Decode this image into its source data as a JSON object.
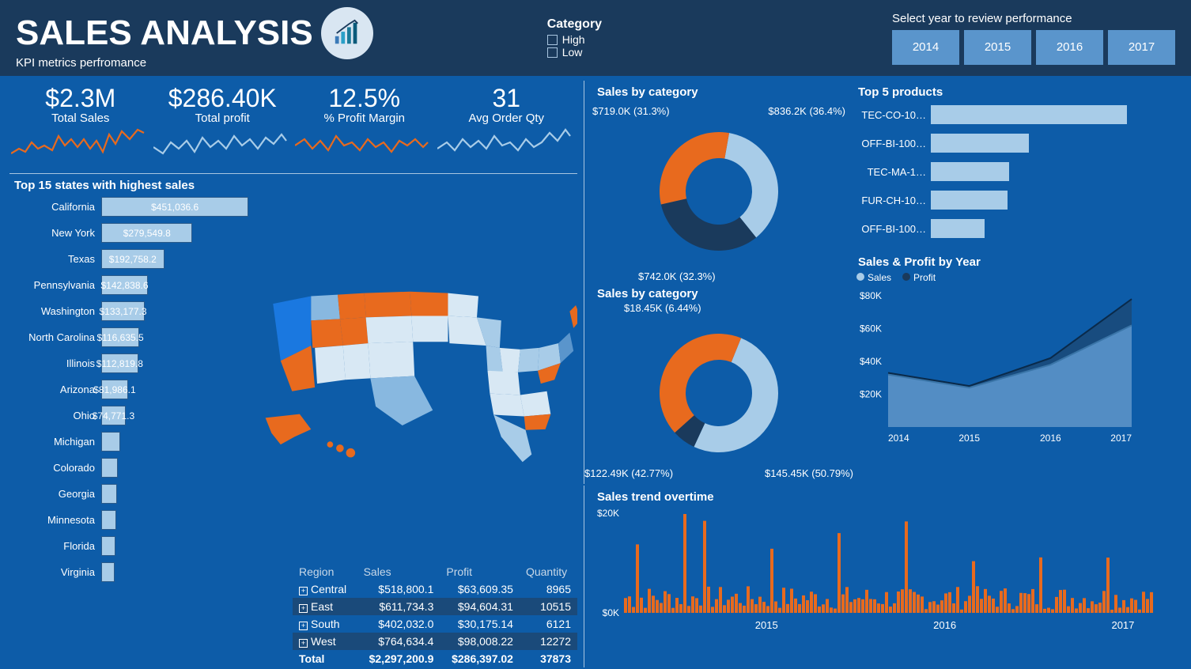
{
  "header": {
    "title": "SALES ANALYSIS",
    "subtitle": "KPI metrics perfromance",
    "category_label": "Category",
    "cat_high": "High",
    "cat_low": "Low",
    "year_label": "Select year to review performance",
    "years": [
      "2014",
      "2015",
      "2016",
      "2017"
    ]
  },
  "kpi": {
    "total_sales": {
      "value": "$2.3M",
      "label": "Total Sales"
    },
    "total_profit": {
      "value": "$286.40K",
      "label": "Total profit"
    },
    "margin": {
      "value": "12.5%",
      "label": "% Profit Margin"
    },
    "avg_qty": {
      "value": "31",
      "label": "Avg Order Qty"
    }
  },
  "top_states_title": "Top 15 states with highest sales",
  "region_headers": {
    "region": "Region",
    "sales": "Sales",
    "profit": "Profit",
    "qty": "Quantity",
    "total": "Total"
  },
  "region_table": {
    "rows": [
      {
        "region": "Central",
        "sales": "$518,800.1",
        "profit": "$63,609.35",
        "qty": "8965",
        "hl": false
      },
      {
        "region": "East",
        "sales": "$611,734.3",
        "profit": "$94,604.31",
        "qty": "10515",
        "hl": true
      },
      {
        "region": "South",
        "sales": "$402,032.0",
        "profit": "$30,175.14",
        "qty": "6121",
        "hl": false
      },
      {
        "region": "West",
        "sales": "$764,634.4",
        "profit": "$98,008.22",
        "qty": "12272",
        "hl": true
      }
    ],
    "total": {
      "sales": "$2,297,200.9",
      "profit": "$286,397.02",
      "qty": "37873"
    }
  },
  "sales_cat1_title": "Sales by category",
  "sales_cat2_title": "Sales by category",
  "top5_title": "Top 5 products",
  "sp_year_title": "Sales & Profit by Year",
  "sp_legend": {
    "s": "Sales",
    "p": "Profit"
  },
  "trend_title": "Sales trend overtime",
  "chart_data": {
    "top_states": {
      "type": "bar",
      "max": 460000,
      "items": [
        {
          "name": "California",
          "value": 451036.6,
          "label": "$451,036.6"
        },
        {
          "name": "New York",
          "value": 279549.8,
          "label": "$279,549.8"
        },
        {
          "name": "Texas",
          "value": 192758.2,
          "label": "$192,758.2"
        },
        {
          "name": "Pennsylvania",
          "value": 142838.6,
          "label": "$142,838.6"
        },
        {
          "name": "Washington",
          "value": 133177.3,
          "label": "$133,177.3"
        },
        {
          "name": "North Carolina",
          "value": 116635.5,
          "label": "$116,635.5"
        },
        {
          "name": "Illinois",
          "value": 112819.8,
          "label": "$112,819.8"
        },
        {
          "name": "Arizona",
          "value": 81986.1,
          "label": "$81,986.1"
        },
        {
          "name": "Ohio",
          "value": 74771.3,
          "label": "$74,771.3"
        },
        {
          "name": "Michigan",
          "value": 58000,
          "label": ""
        },
        {
          "name": "Colorado",
          "value": 52000,
          "label": ""
        },
        {
          "name": "Georgia",
          "value": 49000,
          "label": ""
        },
        {
          "name": "Minnesota",
          "value": 46000,
          "label": ""
        },
        {
          "name": "Florida",
          "value": 44000,
          "label": ""
        },
        {
          "name": "Virginia",
          "value": 41000,
          "label": ""
        }
      ]
    },
    "donut1": {
      "type": "pie",
      "slices": [
        {
          "label": "$836.2K (36.4%)",
          "value": 36.4,
          "color": "#a8cce8"
        },
        {
          "label": "$742.0K (32.3%)",
          "value": 32.3,
          "color": "#1a3a5c"
        },
        {
          "label": "$719.0K (31.3%)",
          "value": 31.3,
          "color": "#e86a1e"
        }
      ]
    },
    "donut2": {
      "type": "pie",
      "slices": [
        {
          "label": "$145.45K (50.79%)",
          "value": 50.79,
          "color": "#a8cce8"
        },
        {
          "label": "$18.45K (6.44%)",
          "value": 6.44,
          "color": "#1a3a5c"
        },
        {
          "label": "$122.49K (42.77%)",
          "value": 42.77,
          "color": "#e86a1e"
        }
      ]
    },
    "top5": {
      "type": "bar",
      "max": 210,
      "items": [
        {
          "name": "TEC-CO-10…",
          "value": 200
        },
        {
          "name": "OFF-BI-100…",
          "value": 100
        },
        {
          "name": "TEC-MA-1…",
          "value": 80
        },
        {
          "name": "FUR-CH-10…",
          "value": 78
        },
        {
          "name": "OFF-BI-100…",
          "value": 55
        }
      ]
    },
    "sales_profit_year": {
      "type": "area",
      "x": [
        "2014",
        "2015",
        "2016",
        "2017"
      ],
      "yticks": [
        "$20K",
        "$40K",
        "$60K",
        "$80K"
      ],
      "series": [
        {
          "name": "Profit",
          "color": "#1a4a7a",
          "y": [
            33,
            25,
            42,
            78
          ]
        },
        {
          "name": "Sales",
          "color": "#5a95cc",
          "y": [
            32,
            24,
            38,
            62
          ]
        }
      ]
    },
    "trend": {
      "type": "bar",
      "yticks": [
        "$0K",
        "$20K"
      ],
      "xticks": [
        "2015",
        "2016",
        "2017"
      ]
    }
  }
}
